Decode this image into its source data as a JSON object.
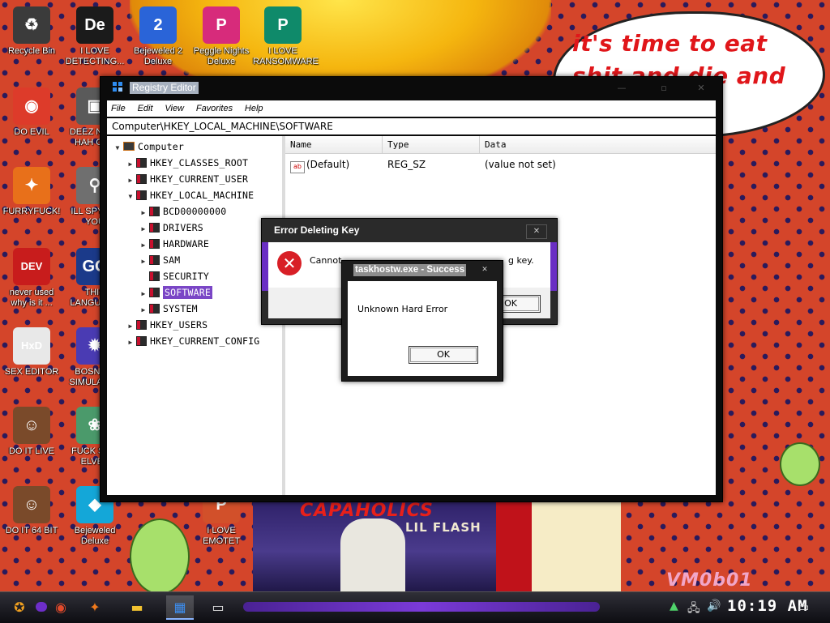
{
  "wallpaper": {
    "speech_text": "it's time to eat shit and die and chew",
    "poster_title": "CAPAHOLICS",
    "poster_sub": "LIL FLASH",
    "watermark": "VM0b01"
  },
  "desktop_icons": [
    {
      "label": "Recycle Bin",
      "icon": "recycle-bin-icon",
      "glyph": "♻",
      "color": "#3b3b3b"
    },
    {
      "label": "I LOVE DETECTING...",
      "icon": "detect-it-easy-icon",
      "glyph": "De",
      "color": "#1b1b1b"
    },
    {
      "label": "Bejeweled 2 Deluxe",
      "icon": "bejeweled-2-icon",
      "glyph": "2",
      "color": "#2a64d8"
    },
    {
      "label": "Peggle Nights Deluxe",
      "icon": "peggle-icon",
      "glyph": "P",
      "color": "#d72b7b"
    },
    {
      "label": "I LOVE RANSOMWARE",
      "icon": "publisher-icon",
      "glyph": "P",
      "color": "#0f8a6a"
    },
    {
      "label": "DO EVIL",
      "icon": "chrome-icon",
      "glyph": "◉",
      "color": "#dd3b2a"
    },
    {
      "label": "DEEZ NUTS HAH GOT",
      "icon": "copy-icon",
      "glyph": "▣",
      "color": "#5a5a5a"
    },
    {
      "label": "FURRYFUCK!",
      "icon": "firefox-icon",
      "glyph": "✦",
      "color": "#e8701a"
    },
    {
      "label": "ILL SPY ON YOU",
      "icon": "spy-icon",
      "glyph": "⚲",
      "color": "#6f6f6f"
    },
    {
      "label": "never used why is it ...",
      "icon": "devcpp-icon",
      "glyph": "DEV",
      "color": "#c81c1c"
    },
    {
      "label": "THIS LANGUAGE",
      "icon": "go-icon",
      "glyph": "GO",
      "color": "#1b3a8a"
    },
    {
      "label": "SEX EDITOR",
      "icon": "hxd-icon",
      "glyph": "HxD",
      "color": "#e8e8e8"
    },
    {
      "label": "BOSNIAN SIMULATOR",
      "icon": "bosnia-icon",
      "glyph": "✹",
      "color": "#4a3bb3"
    },
    {
      "label": "DO IT LIVE",
      "icon": "portrait-icon",
      "glyph": "☺",
      "color": "#7a4a2a"
    },
    {
      "label": "FUCK SHIT ELVES",
      "icon": "elves-icon",
      "glyph": "❀",
      "color": "#4b9a6b"
    },
    {
      "label": "DO IT 64 BIT",
      "icon": "portrait-64-icon",
      "glyph": "☺",
      "color": "#7a4a2a"
    },
    {
      "label": "Bejeweled Deluxe",
      "icon": "bejeweled-icon",
      "glyph": "◆",
      "color": "#14a7d8"
    },
    {
      "label": "I LOVE EMOTET",
      "icon": "emotet-doc-icon",
      "glyph": "P",
      "color": "#d2502a"
    }
  ],
  "regedit": {
    "title": "Registry Editor",
    "menu": [
      "File",
      "Edit",
      "View",
      "Favorites",
      "Help"
    ],
    "address": "Computer\\HKEY_LOCAL_MACHINE\\SOFTWARE",
    "tree": [
      {
        "label": "Computer",
        "level": 0,
        "arrow": "▼",
        "kind": "pc"
      },
      {
        "label": "HKEY_CLASSES_ROOT",
        "level": 1,
        "arrow": "▶",
        "kind": "folder"
      },
      {
        "label": "HKEY_CURRENT_USER",
        "level": 1,
        "arrow": "▶",
        "kind": "folder"
      },
      {
        "label": "HKEY_LOCAL_MACHINE",
        "level": 1,
        "arrow": "▼",
        "kind": "folder"
      },
      {
        "label": "BCD00000000",
        "level": 2,
        "arrow": "▶",
        "kind": "folder"
      },
      {
        "label": "DRIVERS",
        "level": 2,
        "arrow": "▶",
        "kind": "folder"
      },
      {
        "label": "HARDWARE",
        "level": 2,
        "arrow": "▶",
        "kind": "folder"
      },
      {
        "label": "SAM",
        "level": 2,
        "arrow": "▶",
        "kind": "folder"
      },
      {
        "label": "SECURITY",
        "level": 2,
        "arrow": "",
        "kind": "folder"
      },
      {
        "label": "SOFTWARE",
        "level": 2,
        "arrow": "▶",
        "kind": "folder",
        "selected": true
      },
      {
        "label": "SYSTEM",
        "level": 2,
        "arrow": "▶",
        "kind": "folder"
      },
      {
        "label": "HKEY_USERS",
        "level": 1,
        "arrow": "▶",
        "kind": "folder"
      },
      {
        "label": "HKEY_CURRENT_CONFIG",
        "level": 1,
        "arrow": "▶",
        "kind": "folder"
      }
    ],
    "columns": [
      "Name",
      "Type",
      "Data"
    ],
    "values": [
      {
        "name": "(Default)",
        "type": "REG_SZ",
        "data": "(value not set)"
      }
    ]
  },
  "error_dialog": {
    "title": "Error Deleting Key",
    "message_start": "Cannot",
    "message_end": "g key.",
    "ok": "OK",
    "close": "✕"
  },
  "success_dialog": {
    "title": "taskhostw.exe - Success",
    "message": "Unknown Hard Error",
    "ok": "OK",
    "close": "✕"
  },
  "taskbar": {
    "start_icon": "start-icon",
    "items": [
      {
        "name": "chrome-icon",
        "glyph": "◉",
        "color": "#e24a2b"
      },
      {
        "name": "firefox-icon",
        "glyph": "✦",
        "color": "#f07a1c"
      },
      {
        "name": "file-explorer-icon",
        "glyph": "▬",
        "color": "#f2c230"
      },
      {
        "name": "regedit-icon",
        "glyph": "▦",
        "color": "#3d8ff0",
        "active": true
      },
      {
        "name": "window-icon",
        "glyph": "▭",
        "color": "#e8e8e8"
      }
    ],
    "clock": "10:19 AM"
  }
}
